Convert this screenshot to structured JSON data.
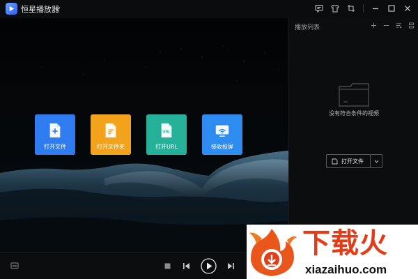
{
  "app": {
    "title": "恒星播放器"
  },
  "titlebar": {
    "icons": [
      "feedback-icon",
      "skin-icon",
      "mini-mode-icon",
      "minimize-icon",
      "maximize-icon",
      "close-icon"
    ]
  },
  "open_tiles": [
    {
      "label": "打开文件",
      "icon": "open-file-icon",
      "color": "#2f7bf0"
    },
    {
      "label": "打开文件夹",
      "icon": "open-folder-icon",
      "color": "#f3a21c"
    },
    {
      "label": "打开URL",
      "icon": "open-url-icon",
      "color": "#25b09a"
    },
    {
      "label": "接收投屏",
      "icon": "cast-receive-icon",
      "color": "#2e8cf0"
    }
  ],
  "playlist": {
    "title": "播放列表",
    "empty_text": "没有符合条件的视频",
    "open_button": "打开文件",
    "actions": [
      "add-icon",
      "remove-icon",
      "sort-icon",
      "list-mode-icon"
    ]
  },
  "controls": {
    "buttons": [
      "subtitle-icon",
      "stop-icon",
      "previous-icon",
      "play-icon",
      "next-icon"
    ]
  },
  "watermark": {
    "name": "下载火",
    "url": "xiazaihuo.com"
  },
  "colors": {
    "accent": "#2f7bf0",
    "panel_bg": "#0c0d0f",
    "watermark_red": "#e23c18"
  }
}
